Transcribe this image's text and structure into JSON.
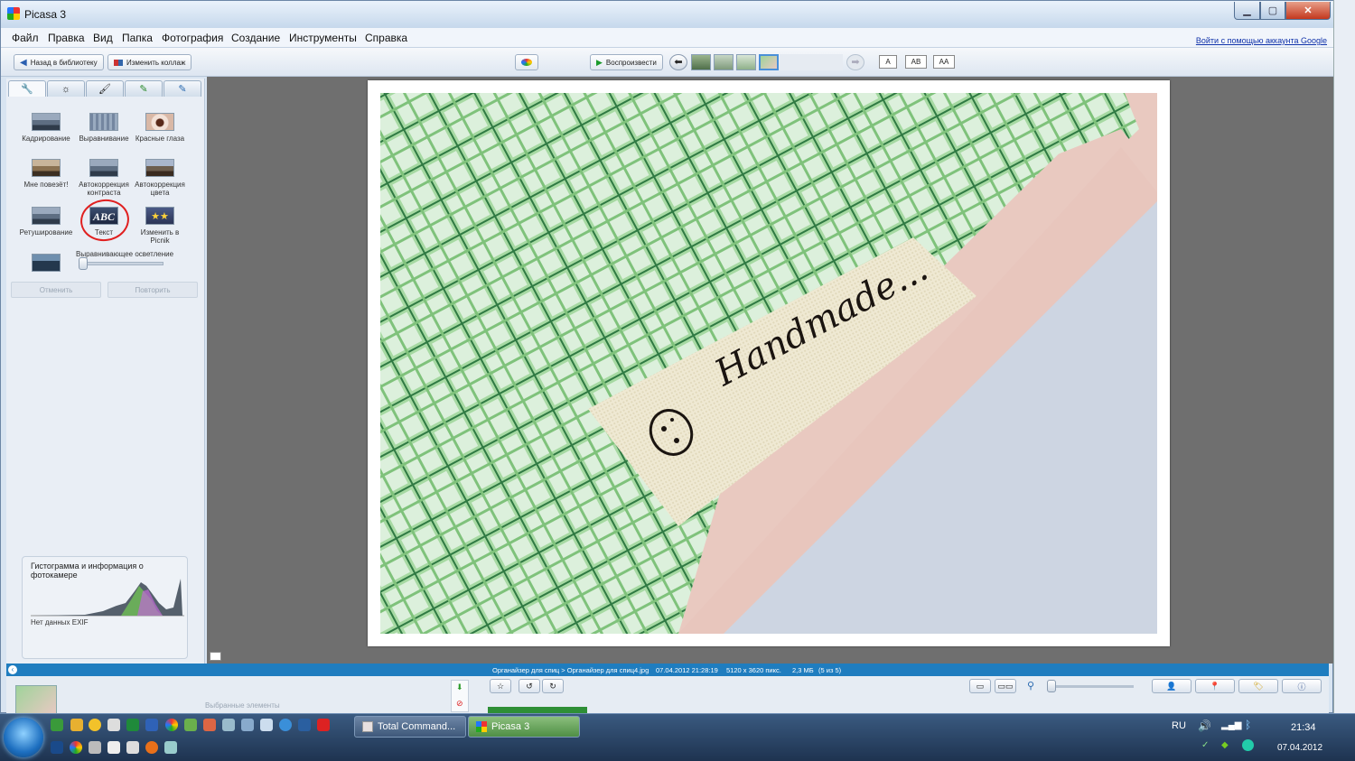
{
  "window": {
    "title": "Picasa 3",
    "minimize": "▁",
    "maximize": "▢",
    "close": "✕"
  },
  "menu": {
    "items": [
      "Файл",
      "Правка",
      "Вид",
      "Папка",
      "Фотография",
      "Создание",
      "Инструменты",
      "Справка"
    ],
    "google_link": "Войти с помощью аккаунта Google"
  },
  "toolbar": {
    "back_label": "Назад в библиотеку",
    "collage_label": "Изменить коллаж",
    "play_label": "Воспроизвести",
    "text_sizes": [
      "A",
      "AB",
      "AA"
    ]
  },
  "tools": {
    "crop": "Кадрирование",
    "straighten": "Выравнивание",
    "redeye": "Красные глаза",
    "lucky": "Мне повезёт!",
    "autocontrast": "Автокоррекция контраста",
    "autocolor": "Автокоррекция цвета",
    "retouch": "Ретуширование",
    "text": "Текст",
    "abc": "ABC",
    "picnik": "Изменить в Picnik",
    "filllight": "Выравнивающее осветление",
    "undo": "Отменить",
    "redo": "Повторить"
  },
  "histogram": {
    "title": "Гистограмма и информация о фотокамере",
    "exif": "Нет данных EXIF"
  },
  "photo": {
    "label_text": "Handmade..."
  },
  "status": {
    "path": "Органайзер для спиц > Органайзер для спиц4.jpg",
    "datetime": "07.04.2012 21:28:19",
    "dimensions": "5120 x 3620 пикс.",
    "size": "2,3 МБ",
    "position": "(5 из 5)"
  },
  "tray": {
    "selected_label": "Выбранные элементы"
  },
  "taskbar": {
    "tasks": [
      "Total Command...",
      "Picasa 3"
    ],
    "lang": "RU",
    "time": "21:34",
    "date": "07.04.2012"
  },
  "colors": {
    "status_bar": "#1f7dbf",
    "close_button": "#c3381e",
    "highlight_circle": "#e02020"
  }
}
